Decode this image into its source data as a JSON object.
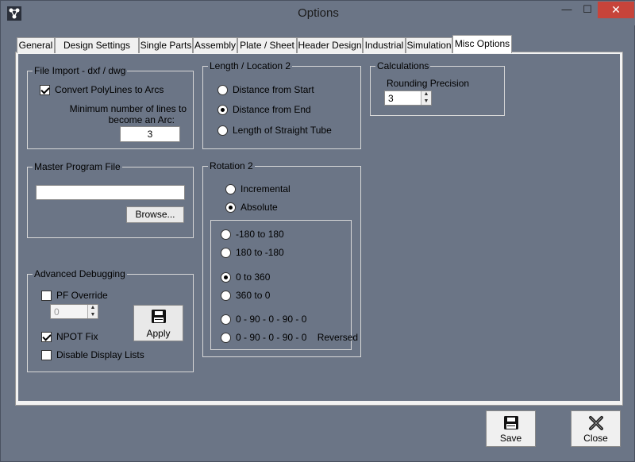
{
  "window": {
    "title": "Options",
    "minimize_glyph": "—",
    "maximize_glyph": "☐",
    "close_glyph": "✕"
  },
  "tabs": [
    {
      "label": "General"
    },
    {
      "label": "Design Settings"
    },
    {
      "label": "Single Parts"
    },
    {
      "label": "Assembly"
    },
    {
      "label": "Plate / Sheet"
    },
    {
      "label": "Header Design"
    },
    {
      "label": "Industrial"
    },
    {
      "label": "Simulation"
    },
    {
      "label": "Misc Options",
      "active": true
    }
  ],
  "file_import": {
    "title": "File Import - dxf / dwg",
    "convert_label": "Convert PolyLines to Arcs",
    "convert_checked": true,
    "min_lines_label_1": "Minimum number of lines to",
    "min_lines_label_2": "become an Arc:",
    "min_lines_value": "3"
  },
  "master_program": {
    "title": "Master Program File",
    "path_value": "",
    "browse_label": "Browse..."
  },
  "advanced_debugging": {
    "title": "Advanced Debugging",
    "pf_override_label": "PF Override",
    "pf_override_checked": false,
    "pf_value": "0",
    "npot_label": "NPOT Fix",
    "npot_checked": true,
    "disable_lists_label": "Disable Display Lists",
    "disable_lists_checked": false,
    "apply_label": "Apply"
  },
  "length_location": {
    "title": "Length / Location 2",
    "options": [
      {
        "label": "Distance from Start",
        "checked": false
      },
      {
        "label": "Distance from End",
        "checked": true
      },
      {
        "label": "Length of Straight Tube",
        "checked": false
      }
    ]
  },
  "rotation": {
    "title": "Rotation 2",
    "modes": [
      {
        "label": "Incremental",
        "checked": false
      },
      {
        "label": "Absolute",
        "checked": true
      }
    ],
    "ranges": [
      {
        "label": "-180  to  180",
        "checked": false
      },
      {
        "label": "180  to  -180",
        "checked": false
      },
      {
        "label": "0  to  360",
        "checked": true
      },
      {
        "label": "360  to  0",
        "checked": false
      },
      {
        "label": "0 - 90 - 0 - 90 - 0",
        "checked": false
      },
      {
        "label": "0 - 90 - 0 - 90 - 0    Reversed",
        "checked": false
      }
    ]
  },
  "calculations": {
    "title": "Calculations",
    "rounding_label": "Rounding Precision",
    "rounding_value": "3"
  },
  "footer": {
    "save_label": "Save",
    "close_label": "Close"
  },
  "icons": {
    "app": "app-logo-icon",
    "save": "floppy-disk-icon",
    "close": "close-x-icon"
  }
}
